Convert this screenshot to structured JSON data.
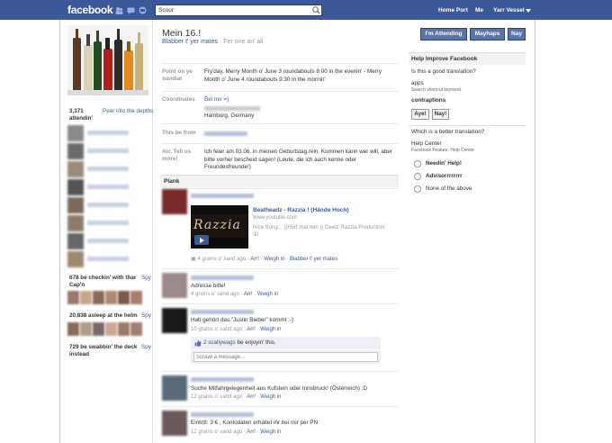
{
  "topbar": {
    "logo": "facebook",
    "search_value": "Scour",
    "nav": [
      "Home Port",
      "Me",
      "Yarr Vessel"
    ]
  },
  "event": {
    "title": "Mein 16.!",
    "subtitle_link": "Blabber t' yer mates",
    "subtitle_sep": "·",
    "subtitle_rest": "Fer one an' all",
    "rows": [
      {
        "label": "Point on ye sundial",
        "value": "Fry'day, Merry Month o' June 3 roundabouts 8:00 in the evenin' - Merry Month o' June 4 roundabouts 9:30 in the mornin'"
      },
      {
        "label": "Coordinates",
        "link": "Bei mir =)",
        "value": "Hamburg, Germany"
      },
      {
        "label": "This be from"
      },
      {
        "label": "Arr, Tell us more!",
        "value": "Ich feier am 03.06. in meinen Geburtstag rein. Kommen kann wer will, aber bitte vorher bescheid sagen! (Leute, die ich auch kenne oder Freundesfreunde!)"
      }
    ]
  },
  "wall": {
    "header": "Plank",
    "video": {
      "thumb_text": "Razzia",
      "title": "Beatheadz - Razzia ! (Hände Hoch)",
      "url": "www.youtube.com",
      "desc": "Nice Song... ((Hört mal rein )) Geelz Razzia Production :D",
      "meta_time": "4 grains o' sand ago",
      "meta_a1": "Arr!",
      "meta_a2": "Weigh in",
      "meta_a3": "Blabber t' yer mates"
    },
    "posts": [
      {
        "text": "Adresse bitte!",
        "time": "4 grains o' sand ago",
        "a1": "Arr!",
        "a2": "Weigh in"
      },
      {
        "text": "Hab gehört das \"Justin Bieber\" kommt :-)",
        "time": "10 grains o' sand ago",
        "a1": "Arr!",
        "a2": "Weigh in"
      },
      {
        "text": "Suche Mitfahrgelegenheit aus Kufstein oder Innsbruck! (Österreich) :D",
        "time": "12 grains o' sand ago",
        "a1": "Arr!",
        "a2": "Weigh in"
      },
      {
        "text": "Eintritt: 3 € , Kontodaten erhaltet ihr bei mir per PN",
        "time": "12 grains o' sand ago",
        "a1": "Arr!",
        "a2": "Weigh in"
      }
    ],
    "likes_link": "2 scallywags",
    "likes_text": "be enjoyin' this.",
    "comment_placeholder": "Scrawl a message..."
  },
  "left": {
    "attending_count": "3,371",
    "attending_label": "attendin'",
    "peer_link": "Peer into the depths",
    "maybe_label": "678 be checkin' with thar Cap'n",
    "spy": "Spy",
    "asleep_label": "20,838 asleep at the helm",
    "swabbin_label": "729 be swabbin' the deck instead"
  },
  "rsvp": {
    "attending": "I'm Attending",
    "maybe": "Mayhaps",
    "nay": "Nay"
  },
  "help": {
    "header": "Help Improve Facebook",
    "question1": "Is this a good translation?",
    "term1": "apps",
    "term1_sub": "Search shortcut keyword",
    "term2": "contraptions",
    "yes": "Aye!",
    "no": "Nay!",
    "question2": "Which is a better translation?",
    "term3": "Help Center",
    "term3_sub": "Facebook Feature: Help Center",
    "options": [
      "Needin' Help!",
      "Advisorrrrrrrr",
      "None of the above"
    ]
  },
  "colors": {
    "brand": "#3b5998",
    "button": "#5b74a8"
  }
}
